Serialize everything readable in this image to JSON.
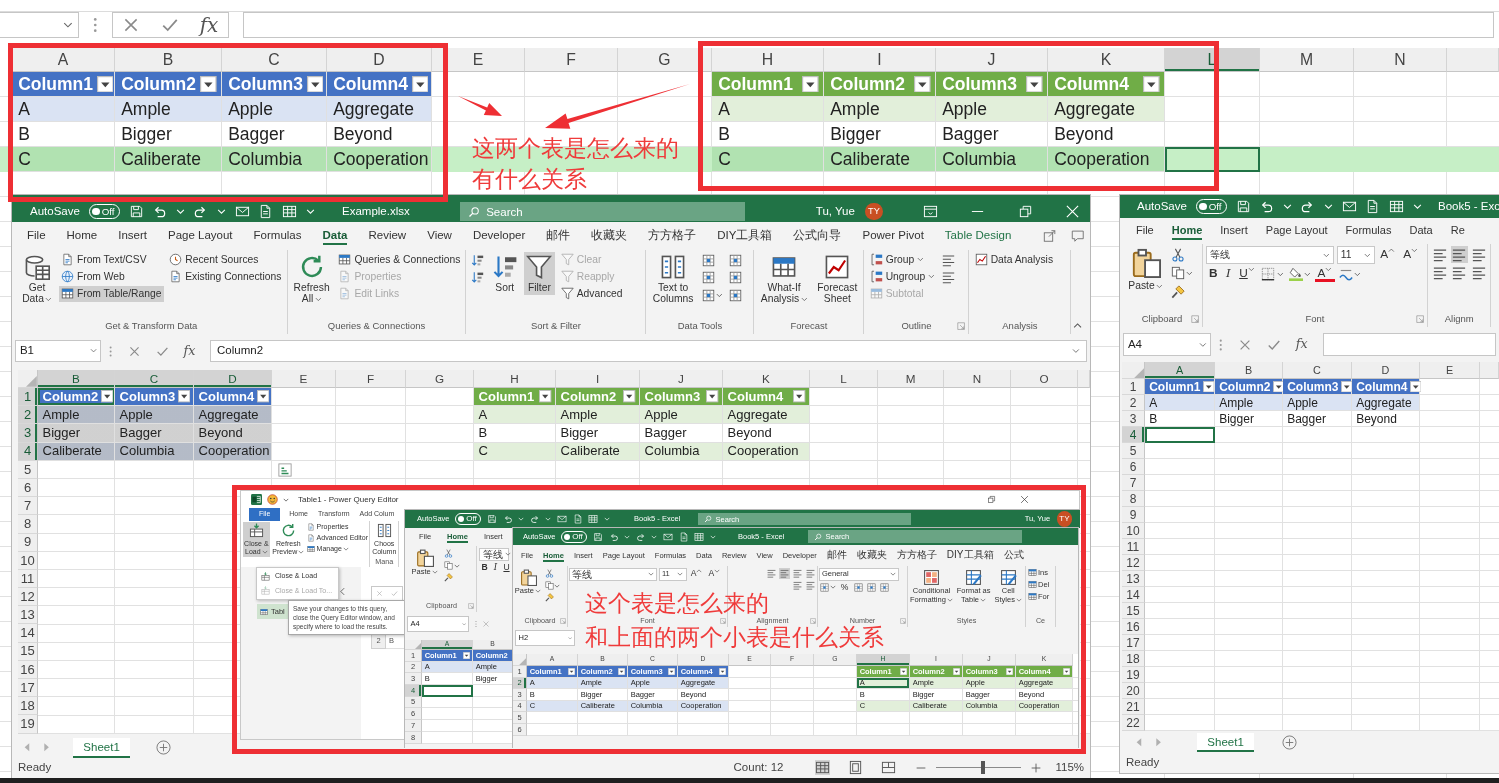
{
  "background_sheet": {
    "formula_bar": {
      "fx": "fx"
    },
    "columns": [
      {
        "label": "A",
        "selected": false
      },
      {
        "label": "B",
        "selected": false
      },
      {
        "label": "C",
        "selected": false
      },
      {
        "label": "D",
        "selected": false
      },
      {
        "label": "E",
        "selected": false
      },
      {
        "label": "F",
        "selected": false
      },
      {
        "label": "G",
        "selected": false
      },
      {
        "label": "H",
        "selected": false
      },
      {
        "label": "I",
        "selected": false
      },
      {
        "label": "J",
        "selected": false
      },
      {
        "label": "K",
        "selected": false
      },
      {
        "label": "L",
        "selected": true
      },
      {
        "label": "M",
        "selected": false
      },
      {
        "label": "N",
        "selected": false
      }
    ],
    "tables": [
      {
        "color": "#4472c4",
        "headers": [
          "Column1",
          "Column2",
          "Column3",
          "Column4"
        ],
        "rows": [
          {
            "cells": [
              "A",
              "Ample",
              "Apple",
              "Aggregate"
            ],
            "banded": true,
            "highlighted": false
          },
          {
            "cells": [
              "B",
              "Bigger",
              "Bagger",
              "Beyond"
            ],
            "banded": false,
            "highlighted": false
          },
          {
            "cells": [
              "C",
              "Caliberate",
              "Columbia",
              "Cooperation"
            ],
            "banded": true,
            "highlighted": true
          }
        ]
      },
      {
        "color": "#70ad47",
        "headers": [
          "Column1",
          "Column2",
          "Column3",
          "Column4"
        ],
        "rows": [
          {
            "cells": [
              "A",
              "Ample",
              "Apple",
              "Aggregate"
            ],
            "banded": true,
            "highlighted": false
          },
          {
            "cells": [
              "B",
              "Bigger",
              "Bagger",
              "Beyond"
            ],
            "banded": false,
            "highlighted": false
          },
          {
            "cells": [
              "C",
              "Caliberate",
              "Columbia",
              "Cooperation"
            ],
            "banded": true,
            "highlighted": true
          }
        ]
      }
    ]
  },
  "annotations": [
    {
      "lines": [
        "这两个表是怎么来的",
        "有什么关系"
      ]
    }
  ],
  "main_window": {
    "title_bar": {
      "autosave": "AutoSave",
      "toggle": "Off",
      "autosave_on": false,
      "file_name": "Example.xlsx",
      "search": {
        "placeholder": "Search"
      },
      "user": "Tu, Yue",
      "avatar": "TY"
    },
    "tabs": [
      {
        "label": "File",
        "selected": false,
        "kind": "standard"
      },
      {
        "label": "Home",
        "selected": false,
        "kind": "standard"
      },
      {
        "label": "Insert",
        "selected": false,
        "kind": "standard"
      },
      {
        "label": "Page Layout",
        "selected": false,
        "kind": "standard"
      },
      {
        "label": "Formulas",
        "selected": false,
        "kind": "standard"
      },
      {
        "label": "Data",
        "selected": true,
        "kind": "standard"
      },
      {
        "label": "Review",
        "selected": false,
        "kind": "standard"
      },
      {
        "label": "View",
        "selected": false,
        "kind": "standard"
      },
      {
        "label": "Developer",
        "selected": false,
        "kind": "standard"
      },
      {
        "label": "邮件",
        "selected": false,
        "kind": "standard"
      },
      {
        "label": "收藏夹",
        "selected": false,
        "kind": "standard"
      },
      {
        "label": "方方格子",
        "selected": false,
        "kind": "standard"
      },
      {
        "label": "DIY工具箱",
        "selected": false,
        "kind": "standard"
      },
      {
        "label": "公式向导",
        "selected": false,
        "kind": "standard"
      },
      {
        "label": "Power Pivot",
        "selected": false,
        "kind": "standard"
      },
      {
        "label": "Table Design",
        "selected": false,
        "kind": "contextual"
      }
    ],
    "ribbon": [
      {
        "label": "Get & Transform Data",
        "items": [
          {
            "kind": "large",
            "label": "Get Data",
            "dropdown": true
          },
          {
            "kind": "stack",
            "items": [
              {
                "kind": "small",
                "label": "From Text/CSV",
                "active": false
              },
              {
                "kind": "small",
                "label": "From Web",
                "active": false
              },
              {
                "kind": "small",
                "label": "From Table/Range",
                "active": true
              }
            ]
          },
          {
            "kind": "stack",
            "items": [
              {
                "kind": "small",
                "label": "Recent Sources"
              },
              {
                "kind": "small",
                "label": "Existing Connections"
              }
            ]
          }
        ]
      },
      {
        "label": "Queries & Connections",
        "items": [
          {
            "kind": "large",
            "label": "Refresh All",
            "dropdown": true
          },
          {
            "kind": "stack",
            "items": [
              {
                "kind": "small",
                "label": "Queries & Connections",
                "disabled": false
              },
              {
                "kind": "small",
                "label": "Properties",
                "disabled": true
              },
              {
                "kind": "small",
                "label": "Edit Links",
                "disabled": true
              }
            ]
          }
        ]
      },
      {
        "label": "Sort & Filter",
        "items": [
          {
            "kind": "stack",
            "items": [
              {
                "kind": "icon"
              },
              {
                "kind": "icon"
              }
            ]
          },
          {
            "kind": "large",
            "label": "Sort",
            "active": false
          },
          {
            "kind": "large",
            "label": "Filter",
            "active": true
          },
          {
            "kind": "stack",
            "items": [
              {
                "kind": "small",
                "label": "Clear",
                "disabled": true
              },
              {
                "kind": "small",
                "label": "Reapply",
                "disabled": true
              },
              {
                "kind": "small",
                "label": "Advanced",
                "disabled": false
              }
            ]
          }
        ]
      },
      {
        "label": "Data Tools",
        "items": [
          {
            "kind": "large",
            "label": "Text to Columns"
          },
          {
            "kind": "stack",
            "items": [
              {
                "kind": "icon"
              },
              {
                "kind": "icon"
              },
              {
                "kind": "icon",
                "dropdown": true
              }
            ]
          },
          {
            "kind": "stack",
            "items": [
              {
                "kind": "icon"
              },
              {
                "kind": "icon"
              },
              {
                "kind": "icon"
              }
            ]
          }
        ]
      },
      {
        "label": "Forecast",
        "items": [
          {
            "kind": "large",
            "label": "What-If Analysis",
            "dropdown": true
          },
          {
            "kind": "large",
            "label": "Forecast Sheet"
          }
        ]
      },
      {
        "label": "Outline",
        "launcher": true,
        "items": [
          {
            "kind": "stack",
            "items": [
              {
                "kind": "small",
                "label": "Group",
                "dropdown": true,
                "disabled": false
              },
              {
                "kind": "small",
                "label": "Ungroup",
                "dropdown": true,
                "disabled": false
              },
              {
                "kind": "small",
                "label": "Subtotal",
                "disabled": true
              }
            ]
          },
          {
            "kind": "stack",
            "items": [
              {
                "kind": "icon"
              },
              {
                "kind": "icon"
              }
            ]
          }
        ]
      },
      {
        "label": "Analysis",
        "items": [
          {
            "kind": "stack",
            "items": [
              {
                "kind": "small",
                "label": "Data Analysis"
              }
            ]
          }
        ]
      }
    ],
    "formula_bar": {
      "name_box": "B1",
      "fx": "fx",
      "value": "Column2"
    },
    "grid": {
      "columns": [
        {
          "label": "B",
          "selected": true
        },
        {
          "label": "C",
          "selected": true
        },
        {
          "label": "D",
          "selected": true
        },
        {
          "label": "E",
          "selected": false
        },
        {
          "label": "F",
          "selected": false
        },
        {
          "label": "G",
          "selected": false
        },
        {
          "label": "H",
          "selected": false
        },
        {
          "label": "I",
          "selected": false
        },
        {
          "label": "J",
          "selected": false
        },
        {
          "label": "K",
          "selected": false
        },
        {
          "label": "L",
          "selected": false
        },
        {
          "label": "M",
          "selected": false
        },
        {
          "label": "N",
          "selected": false
        },
        {
          "label": "O",
          "selected": false
        }
      ],
      "rows": [
        {
          "label": "1",
          "selected": true
        },
        {
          "label": "2",
          "selected": true
        },
        {
          "label": "3",
          "selected": true
        },
        {
          "label": "4",
          "selected": true
        },
        {
          "label": "5",
          "selected": false
        },
        {
          "label": "6",
          "selected": false
        },
        {
          "label": "7",
          "selected": false
        },
        {
          "label": "8",
          "selected": false
        },
        {
          "label": "9",
          "selected": false
        },
        {
          "label": "10",
          "selected": false
        },
        {
          "label": "11",
          "selected": false
        },
        {
          "label": "12",
          "selected": false
        },
        {
          "label": "13",
          "selected": false
        },
        {
          "label": "14",
          "selected": false
        },
        {
          "label": "15",
          "selected": false
        },
        {
          "label": "16",
          "selected": false
        },
        {
          "label": "17",
          "selected": false
        },
        {
          "label": "18",
          "selected": false
        },
        {
          "label": "19",
          "selected": false
        }
      ],
      "tables": [
        {
          "color": "#4472c4",
          "selected": true,
          "headers": [
            "Column2",
            "Column3",
            "Column4"
          ],
          "rows": [
            {
              "cells": [
                "Ample",
                "Apple",
                "Aggregate"
              ],
              "banded": true
            },
            {
              "cells": [
                "Bigger",
                "Bagger",
                "Beyond"
              ],
              "banded": false
            },
            {
              "cells": [
                "Caliberate",
                "Columbia",
                "Cooperation"
              ],
              "banded": true
            }
          ]
        },
        {
          "color": "#70ad47",
          "selected": false,
          "headers": [
            "Column1",
            "Column2",
            "Column3",
            "Column4"
          ],
          "rows": [
            {
              "cells": [
                "A",
                "Ample",
                "Apple",
                "Aggregate"
              ],
              "banded": true
            },
            {
              "cells": [
                "B",
                "Bigger",
                "Bagger",
                "Beyond"
              ],
              "banded": false
            },
            {
              "cells": [
                "C",
                "Caliberate",
                "Columbia",
                "Cooperation"
              ],
              "banded": true
            }
          ]
        }
      ]
    },
    "sheet_tabs": [
      {
        "label": "Sheet1",
        "selected": true
      }
    ],
    "status_bar": {
      "status": "Ready",
      "count": "Count: 12",
      "views": [
        {
          "selected": true
        },
        {
          "selected": false
        },
        {
          "selected": false
        }
      ],
      "zoom_slider": {
        "level": 0.55
      },
      "zoom": "115%"
    }
  },
  "side_window": {
    "title_bar": {
      "autosave": "AutoSave",
      "toggle": "Off",
      "autosave_on": false,
      "file_name": "Book5 - Exc"
    },
    "tabs": [
      {
        "label": "File",
        "selected": false
      },
      {
        "label": "Home",
        "selected": true
      },
      {
        "label": "Insert",
        "selected": false
      },
      {
        "label": "Page Layout",
        "selected": false
      },
      {
        "label": "Formulas",
        "selected": false
      },
      {
        "label": "Data",
        "selected": false
      },
      {
        "label": "Re",
        "selected": false
      }
    ],
    "ribbon": [
      {
        "label": "Clipboard",
        "launcher": true,
        "items": [
          {
            "kind": "large",
            "label": "Paste",
            "dropdown": true
          },
          {
            "kind": "stack",
            "items": [
              {
                "kind": "icon"
              },
              {
                "kind": "icon",
                "dropdown": true
              },
              {
                "kind": "icon"
              }
            ]
          }
        ]
      },
      {
        "label": "Font",
        "launcher": true,
        "items": [
          {
            "kind": "stack",
            "items": [
              {
                "kind": "row",
                "items": [
                  {
                    "kind": "field",
                    "value": "等线"
                  },
                  {
                    "kind": "field",
                    "value": "11"
                  },
                  {
                    "kind": "grow",
                    "label": "A"
                  },
                  {
                    "kind": "shrink",
                    "label": "A"
                  }
                ]
              },
              {
                "kind": "row",
                "items": [
                  {
                    "kind": "bold",
                    "label": "B"
                  },
                  {
                    "kind": "italic",
                    "label": "I"
                  },
                  {
                    "kind": "underline",
                    "label": "U",
                    "dropdown": true
                  },
                  {
                    "kind": "icon",
                    "dropdown": true
                  },
                  {
                    "kind": "icon",
                    "dropdown": true
                  },
                  {
                    "kind": "letter",
                    "label": "A",
                    "color": "#e81123",
                    "dropdown": true
                  },
                  {
                    "kind": "icon",
                    "dropdown": true
                  }
                ]
              }
            ]
          }
        ]
      },
      {
        "label": "Alignm",
        "items": [
          {
            "kind": "stack",
            "items": [
              {
                "kind": "row",
                "items": [
                  {
                    "kind": "icon",
                    "active": false
                  },
                  {
                    "kind": "icon",
                    "active": true
                  },
                  {
                    "kind": "icon",
                    "active": false
                  }
                ]
              },
              {
                "kind": "row",
                "items": [
                  {
                    "kind": "icon"
                  },
                  {
                    "kind": "icon"
                  },
                  {
                    "kind": "icon"
                  }
                ]
              }
            ]
          }
        ]
      }
    ],
    "formula_bar": {
      "name_box": "A4",
      "fx": "fx"
    },
    "grid": {
      "columns": [
        {
          "label": "A",
          "selected": true
        },
        {
          "label": "B",
          "selected": false
        },
        {
          "label": "C",
          "selected": false
        },
        {
          "label": "D",
          "selected": false
        },
        {
          "label": "E",
          "selected": false
        }
      ],
      "rows": [
        {
          "label": "1",
          "selected": false
        },
        {
          "label": "2",
          "selected": false
        },
        {
          "label": "3",
          "selected": false
        },
        {
          "label": "4",
          "selected": true
        },
        {
          "label": "5",
          "selected": false
        },
        {
          "label": "6",
          "selected": false
        },
        {
          "label": "7",
          "selected": false
        },
        {
          "label": "8",
          "selected": false
        },
        {
          "label": "9",
          "selected": false
        },
        {
          "label": "10",
          "selected": false
        },
        {
          "label": "11",
          "selected": false
        },
        {
          "label": "12",
          "selected": false
        },
        {
          "label": "13",
          "selected": false
        },
        {
          "label": "14",
          "selected": false
        },
        {
          "label": "15",
          "selected": false
        },
        {
          "label": "16",
          "selected": false
        },
        {
          "label": "17",
          "selected": false
        },
        {
          "label": "18",
          "selected": false
        },
        {
          "label": "19",
          "selected": false
        },
        {
          "label": "20",
          "selected": false
        },
        {
          "label": "21",
          "selected": false
        },
        {
          "label": "22",
          "selected": false
        }
      ],
      "tables": [
        {
          "color": "#4472c4",
          "headers": [
            "Column1",
            "Column2",
            "Column3",
            "Column4"
          ],
          "rows": [
            {
              "cells": [
                "A",
                "Ample",
                "Apple",
                "Aggregate"
              ],
              "banded": true
            },
            {
              "cells": [
                "B",
                "Bigger",
                "Bagger",
                "Beyond"
              ],
              "banded": false
            }
          ]
        }
      ]
    },
    "sheet_tabs": [
      {
        "label": "Sheet1",
        "selected": true
      }
    ],
    "status_bar": {
      "status": "Ready"
    }
  },
  "query_collage": {
    "editor": {
      "title": "Table1 - Power Query Editor",
      "tabs": [
        {
          "label": "File",
          "selected": true
        },
        {
          "label": "Home",
          "selected": false
        },
        {
          "label": "Transform",
          "selected": false
        },
        {
          "label": "Add Colum",
          "selected": false
        }
      ],
      "ribbon": [
        {
          "items": [
            {
              "kind": "large",
              "label": "Close & Load",
              "dropdown": true,
              "active": true
            },
            {
              "kind": "large",
              "label": "Refresh Preview",
              "dropdown": true,
              "active": false
            },
            {
              "kind": "stack",
              "items": [
                {
                  "kind": "small",
                  "label": "Properties"
                },
                {
                  "kind": "small",
                  "label": "Advanced Editor"
                },
                {
                  "kind": "small",
                  "label": "Manage",
                  "dropdown": true
                }
              ]
            }
          ]
        },
        {
          "label": "Mana",
          "items": [
            {
              "kind": "large",
              "label": "Choos Column"
            }
          ]
        }
      ],
      "menu": [
        {
          "label": "Close & Load",
          "disabled": false
        },
        {
          "label": "Close & Load To...",
          "disabled": true
        }
      ],
      "tooltip": "Save your changes to this query, close the Query Editor window, and specify where to load the results.",
      "queries": [
        {
          "label": "Tabl",
          "selected": true
        }
      ],
      "grid_fragment": {
        "row_header": "2",
        "cell": "B"
      }
    },
    "windows": [
      {
        "title_bar": {
          "autosave": "AutoSave",
          "toggle": "Off",
          "autosave_on": false,
          "file_name": "Book5 - Excel",
          "search": {
            "placeholder": "Search"
          },
          "user": "Tu, Yue",
          "avatar": "TY"
        },
        "tabs": [
          {
            "label": "File",
            "selected": false
          },
          {
            "label": "Home",
            "selected": true
          },
          {
            "label": "Insert",
            "selected": false
          }
        ],
        "ribbon": [
          {
            "label": "Clipboard",
            "launcher": true,
            "items": [
              {
                "kind": "large",
                "label": "Paste",
                "dropdown": true
              },
              {
                "kind": "stack",
                "items": [
                  {
                    "kind": "icon"
                  },
                  {
                    "kind": "icon",
                    "dropdown": true
                  },
                  {
                    "kind": "icon"
                  }
                ]
              }
            ]
          },
          {
            "items": [
              {
                "kind": "stack",
                "items": [
                  {
                    "kind": "row",
                    "items": [
                      {
                        "kind": "field",
                        "value": "等线"
                      }
                    ]
                  },
                  {
                    "kind": "row",
                    "items": [
                      {
                        "kind": "bold",
                        "label": "B"
                      },
                      {
                        "kind": "italic",
                        "label": "I"
                      },
                      {
                        "kind": "underline",
                        "label": "U"
                      }
                    ]
                  }
                ]
              }
            ]
          }
        ],
        "formula_bar": {
          "name_box": "A4"
        },
        "grid": {
          "columns": [
            {
              "label": "A",
              "selected": true
            },
            {
              "label": "B",
              "selected": false
            }
          ],
          "rows": [
            {
              "label": "1",
              "selected": false
            },
            {
              "label": "2",
              "selected": false
            },
            {
              "label": "3",
              "selected": false
            },
            {
              "label": "4",
              "selected": true
            },
            {
              "label": "5",
              "selected": false
            },
            {
              "label": "6",
              "selected": false
            },
            {
              "label": "7",
              "selected": false
            },
            {
              "label": "8",
              "selected": false
            }
          ],
          "tables": [
            {
              "color": "#4472c4",
              "headers": [
                "Column1",
                "Column2"
              ],
              "rows": [
                {
                  "cells": [
                    "A",
                    "Ample"
                  ],
                  "banded": true
                },
                {
                  "cells": [
                    "B",
                    "Bigger"
                  ],
                  "banded": false
                }
              ]
            }
          ]
        }
      },
      {
        "title_bar": {
          "autosave": "AutoSave",
          "toggle": "Off",
          "autosave_on": false,
          "file_name": "Book5 - Excel",
          "search": {
            "placeholder": "Search"
          }
        },
        "tabs": [
          {
            "label": "File",
            "selected": false
          },
          {
            "label": "Home",
            "selected": true
          },
          {
            "label": "Insert",
            "selected": false
          },
          {
            "label": "Page Layout",
            "selected": false
          },
          {
            "label": "Formulas",
            "selected": false
          },
          {
            "label": "Data",
            "selected": false
          },
          {
            "label": "Review",
            "selected": false
          },
          {
            "label": "View",
            "selected": false
          },
          {
            "label": "Developer",
            "selected": false
          },
          {
            "label": "邮件",
            "selected": false
          },
          {
            "label": "收藏夹",
            "selected": false
          },
          {
            "label": "方方格子",
            "selected": false
          },
          {
            "label": "DIY工具箱",
            "selected": false
          },
          {
            "label": "公式",
            "selected": false
          }
        ],
        "ribbon": [
          {
            "label": "Clipboard",
            "launcher": true,
            "items": [
              {
                "kind": "large",
                "label": "Paste",
                "dropdown": true
              },
              {
                "kind": "stack",
                "items": [
                  {
                    "kind": "icon"
                  },
                  {
                    "kind": "icon",
                    "dropdown": true
                  },
                  {
                    "kind": "icon"
                  }
                ]
              }
            ]
          },
          {
            "label": "Font",
            "launcher": true,
            "items": [
              {
                "kind": "stack",
                "items": [
                  {
                    "kind": "row",
                    "items": [
                      {
                        "kind": "field",
                        "value": "等线"
                      },
                      {
                        "kind": "field",
                        "value": "11"
                      },
                      {
                        "kind": "grow",
                        "label": "A"
                      },
                      {
                        "kind": "shrink",
                        "label": "A"
                      }
                    ]
                  }
                ]
              }
            ]
          },
          {
            "label": "Alignment",
            "launcher": true,
            "items": [
              {
                "kind": "stack",
                "items": [
                  {
                    "kind": "row",
                    "items": [
                      {
                        "kind": "icon",
                        "active": false
                      },
                      {
                        "kind": "icon",
                        "active": true
                      },
                      {
                        "kind": "icon",
                        "active": false
                      },
                      {
                        "kind": "icon",
                        "active": false
                      }
                    ]
                  },
                  {
                    "kind": "row",
                    "items": [
                      {
                        "kind": "icon"
                      },
                      {
                        "kind": "icon"
                      }
                    ]
                  }
                ]
              }
            ]
          },
          {
            "label": "Number",
            "launcher": true,
            "items": [
              {
                "kind": "stack",
                "items": [
                  {
                    "kind": "row",
                    "items": [
                      {
                        "kind": "field",
                        "value": "General"
                      }
                    ]
                  },
                  {
                    "kind": "row",
                    "items": [
                      {
                        "kind": "icon",
                        "dropdown": true
                      },
                      {
                        "kind": "letter",
                        "label": "%"
                      },
                      {
                        "kind": "icon"
                      },
                      {
                        "kind": "icon"
                      },
                      {
                        "kind": "icon"
                      }
                    ]
                  }
                ]
              }
            ]
          },
          {
            "label": "Styles",
            "items": [
              {
                "kind": "large",
                "label": "Conditional Formatting",
                "dropdown": true
              },
              {
                "kind": "large",
                "label": "Format as Table",
                "dropdown": true
              },
              {
                "kind": "large",
                "label": "Cell Styles",
                "dropdown": true
              }
            ]
          },
          {
            "label": "Ce",
            "items": [
              {
                "kind": "stack",
                "items": [
                  {
                    "kind": "small",
                    "label": "Ins"
                  },
                  {
                    "kind": "small",
                    "label": "Del"
                  },
                  {
                    "kind": "small",
                    "label": "For"
                  }
                ]
              }
            ]
          }
        ],
        "formula_bar": {
          "name_box": "H2"
        },
        "grid": {
          "columns": [
            {
              "label": "A",
              "selected": false
            },
            {
              "label": "B",
              "selected": false
            },
            {
              "label": "C",
              "selected": false
            },
            {
              "label": "D",
              "selected": false
            },
            {
              "label": "E",
              "selected": false
            },
            {
              "label": "F",
              "selected": false
            },
            {
              "label": "G",
              "selected": false
            },
            {
              "label": "H",
              "selected": true
            },
            {
              "label": "I",
              "selected": false
            },
            {
              "label": "J",
              "selected": false
            },
            {
              "label": "K",
              "selected": false
            }
          ],
          "rows": [
            {
              "label": "1",
              "selected": false
            },
            {
              "label": "2",
              "selected": true
            },
            {
              "label": "3",
              "selected": false
            },
            {
              "label": "4",
              "selected": false
            },
            {
              "label": "5",
              "selected": false
            },
            {
              "label": "6",
              "selected": false
            }
          ],
          "tables": [
            {
              "color": "#4472c4",
              "headers": [
                "Column1",
                "Column2",
                "Column3",
                "Column4"
              ],
              "rows": [
                {
                  "cells": [
                    "A",
                    "Ample",
                    "Apple",
                    "Aggregate"
                  ],
                  "banded": true
                },
                {
                  "cells": [
                    "B",
                    "Bigger",
                    "Bagger",
                    "Beyond"
                  ],
                  "banded": false
                },
                {
                  "cells": [
                    "C",
                    "Caliberate",
                    "Columbia",
                    "Cooperation"
                  ],
                  "banded": true
                }
              ]
            },
            {
              "color": "#70ad47",
              "headers": [
                "Column1",
                "Column2",
                "Column3",
                "Column4"
              ],
              "rows": [
                {
                  "cells": [
                    "A",
                    "Ample",
                    "Apple",
                    "Aggregate"
                  ],
                  "banded": true
                },
                {
                  "cells": [
                    "B",
                    "Bigger",
                    "Bagger",
                    "Beyond"
                  ],
                  "banded": false
                },
                {
                  "cells": [
                    "C",
                    "Caliberate",
                    "Columbia",
                    "Cooperation"
                  ],
                  "banded": true
                }
              ]
            }
          ]
        }
      }
    ],
    "annotation": {
      "lines": [
        "这个表是怎么来的",
        "和上面的两个小表是什么关系"
      ]
    }
  }
}
